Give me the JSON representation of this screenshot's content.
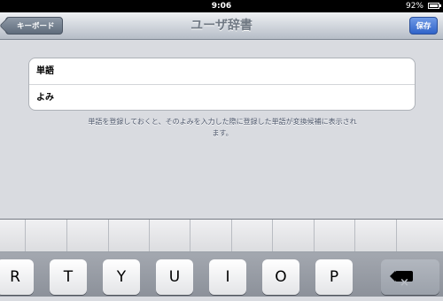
{
  "status_bar": {
    "time": "9:06",
    "battery": "92%"
  },
  "nav_bar": {
    "back_label": "キーボード",
    "title": "ユーザ辞書",
    "save_label": "保存"
  },
  "form": {
    "fields": [
      {
        "label": "単語"
      },
      {
        "label": "よみ"
      }
    ],
    "hint_line1": "単語を登録しておくと、そのよみを入力した際に登録した単語が変換候補に表示され",
    "hint_line2": "ます。"
  },
  "keyboard": {
    "keys": [
      "R",
      "T",
      "Y",
      "U",
      "I",
      "O",
      "P"
    ],
    "delete_icon": "delete-icon"
  }
}
